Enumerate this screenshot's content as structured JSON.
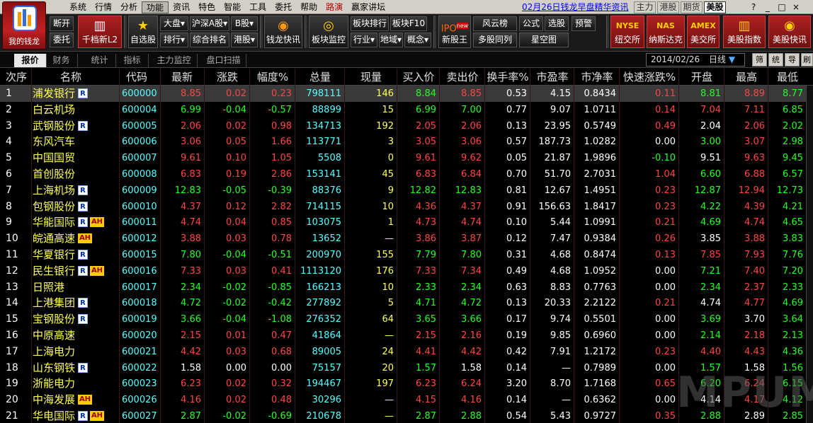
{
  "app": {
    "logo_label": "我的钱龙"
  },
  "menu": [
    "系统",
    "行情",
    "分析",
    "功能",
    "资讯",
    "特色",
    "智能",
    "工具",
    "委托",
    "帮助",
    "路演",
    "赢家讲坛"
  ],
  "menu_active_index": 3,
  "menu_red_index": 10,
  "news_link": "02月26日钱龙早盘精华资讯",
  "market_tabs": [
    "主力",
    "港股",
    "期货",
    "美股"
  ],
  "market_active": "美股",
  "window_controls": [
    "?",
    "_",
    "□",
    "×"
  ],
  "toolbar": {
    "disconnect": "断开",
    "entrust": "委托",
    "l2": "千档新L2",
    "mystock": "自选股",
    "dapan": "大盘",
    "rank": "排行",
    "hushen_a": "沪深A股",
    "composite_rank": "综合排名",
    "b_share": "B股",
    "hk": "港股",
    "qianlong_news": "钱龙快讯",
    "sector_monitor": "板块监控",
    "sector_rank": "板块排行",
    "sector_f10": "板块F10",
    "industry": "行业",
    "region": "地域",
    "concept": "概念",
    "new_stock": "新股王",
    "new_badge": "new",
    "fengyun": "风云榜",
    "multi_stock": "多股同列",
    "formula": "公式",
    "select_stock": "选股",
    "star_map": "星空图",
    "alert": "预警",
    "nyse_logo": "NYSE",
    "nyse": "纽交所",
    "nas_logo": "NAS",
    "nasdaq": "纳斯达克",
    "amex_logo": "AMEX",
    "amex": "美交所",
    "us_index": "美股指数",
    "us_news": "美股快讯"
  },
  "subtabs": [
    "报价",
    "财务",
    "统计",
    "指标",
    "主力监控",
    "盘口扫描"
  ],
  "subtab_active": "报价",
  "date": "2014/02/26",
  "period": "日线",
  "period_arrow": "▼",
  "right_buttons": [
    "筛",
    "统",
    "导",
    "刷"
  ],
  "columns": [
    "次序",
    "名称",
    "代码",
    "最新",
    "涨跌",
    "幅度%",
    "总量",
    "现量",
    "买入价",
    "卖出价",
    "换手率%",
    "市盈率",
    "市净率",
    "快速涨跌%",
    "开盘",
    "最高",
    "最低"
  ],
  "rows": [
    {
      "seq": "1",
      "name": "浦发银行",
      "r": true,
      "ah": false,
      "code": "600000",
      "last": "8.85",
      "chg": "0.02",
      "pct": "0.23",
      "vol": "798111",
      "cur": "146",
      "bid": "8.84",
      "ask": "8.85",
      "turn": "0.53",
      "pe": "4.15",
      "pb": "0.8434",
      "fast": "0.11",
      "open": "8.81",
      "high": "8.89",
      "low": "8.77",
      "dir": "up",
      "fastdir": "up",
      "opendir": "dn",
      "highdir": "up",
      "lowdir": "dn",
      "biddir": "dn",
      "askdir": "up"
    },
    {
      "seq": "2",
      "name": "白云机场",
      "r": false,
      "ah": false,
      "code": "600004",
      "last": "6.99",
      "chg": "-0.04",
      "pct": "-0.57",
      "vol": "88899",
      "cur": "15",
      "bid": "6.99",
      "ask": "7.00",
      "turn": "0.77",
      "pe": "9.07",
      "pb": "1.0711",
      "fast": "0.14",
      "open": "7.04",
      "high": "7.11",
      "low": "6.85",
      "dir": "dn",
      "fastdir": "up",
      "opendir": "up",
      "highdir": "up",
      "lowdir": "dn",
      "biddir": "dn",
      "askdir": "dn"
    },
    {
      "seq": "3",
      "name": "武钢股份",
      "r": true,
      "ah": false,
      "code": "600005",
      "last": "2.06",
      "chg": "0.02",
      "pct": "0.98",
      "vol": "134713",
      "cur": "192",
      "bid": "2.05",
      "ask": "2.06",
      "turn": "0.13",
      "pe": "23.95",
      "pb": "0.5749",
      "fast": "0.49",
      "open": "2.04",
      "high": "2.06",
      "low": "2.02",
      "dir": "up",
      "fastdir": "up",
      "opendir": "flat",
      "highdir": "up",
      "lowdir": "dn",
      "biddir": "up",
      "askdir": "up"
    },
    {
      "seq": "4",
      "name": "东风汽车",
      "r": false,
      "ah": false,
      "code": "600006",
      "last": "3.06",
      "chg": "0.05",
      "pct": "1.66",
      "vol": "113771",
      "cur": "3",
      "bid": "3.05",
      "ask": "3.06",
      "turn": "0.57",
      "pe": "187.73",
      "pb": "1.0282",
      "fast": "0.00",
      "open": "3.00",
      "high": "3.07",
      "low": "2.98",
      "dir": "up",
      "fastdir": "flat",
      "opendir": "dn",
      "highdir": "up",
      "lowdir": "dn",
      "biddir": "up",
      "askdir": "up"
    },
    {
      "seq": "5",
      "name": "中国国贸",
      "r": false,
      "ah": false,
      "code": "600007",
      "last": "9.61",
      "chg": "0.10",
      "pct": "1.05",
      "vol": "5508",
      "cur": "0",
      "bid": "9.61",
      "ask": "9.62",
      "turn": "0.05",
      "pe": "21.87",
      "pb": "1.9896",
      "fast": "-0.10",
      "open": "9.51",
      "high": "9.63",
      "low": "9.45",
      "dir": "up",
      "fastdir": "dn",
      "opendir": "flat",
      "highdir": "up",
      "lowdir": "dn",
      "biddir": "up",
      "askdir": "up"
    },
    {
      "seq": "6",
      "name": "首创股份",
      "r": false,
      "ah": false,
      "code": "600008",
      "last": "6.83",
      "chg": "0.19",
      "pct": "2.86",
      "vol": "153141",
      "cur": "45",
      "bid": "6.83",
      "ask": "6.84",
      "turn": "0.70",
      "pe": "51.70",
      "pb": "2.7031",
      "fast": "1.04",
      "open": "6.60",
      "high": "6.88",
      "low": "6.57",
      "dir": "up",
      "fastdir": "up",
      "opendir": "dn",
      "highdir": "up",
      "lowdir": "dn",
      "biddir": "up",
      "askdir": "up"
    },
    {
      "seq": "7",
      "name": "上海机场",
      "r": true,
      "ah": false,
      "code": "600009",
      "last": "12.83",
      "chg": "-0.05",
      "pct": "-0.39",
      "vol": "88376",
      "cur": "9",
      "bid": "12.82",
      "ask": "12.83",
      "turn": "0.81",
      "pe": "12.67",
      "pb": "1.4951",
      "fast": "0.23",
      "open": "12.87",
      "high": "12.94",
      "low": "12.73",
      "dir": "dn",
      "fastdir": "up",
      "opendir": "dn",
      "highdir": "up",
      "lowdir": "dn",
      "biddir": "dn",
      "askdir": "dn"
    },
    {
      "seq": "8",
      "name": "包钢股份",
      "r": true,
      "ah": false,
      "code": "600010",
      "last": "4.37",
      "chg": "0.12",
      "pct": "2.82",
      "vol": "714115",
      "cur": "10",
      "bid": "4.36",
      "ask": "4.37",
      "turn": "0.91",
      "pe": "156.63",
      "pb": "1.8417",
      "fast": "0.23",
      "open": "4.22",
      "high": "4.39",
      "low": "4.21",
      "dir": "up",
      "fastdir": "up",
      "opendir": "dn",
      "highdir": "up",
      "lowdir": "dn",
      "biddir": "up",
      "askdir": "up"
    },
    {
      "seq": "9",
      "name": "华能国际",
      "r": true,
      "ah": true,
      "code": "600011",
      "last": "4.74",
      "chg": "0.04",
      "pct": "0.85",
      "vol": "103075",
      "cur": "1",
      "bid": "4.73",
      "ask": "4.74",
      "turn": "0.10",
      "pe": "5.44",
      "pb": "1.0991",
      "fast": "0.21",
      "open": "4.69",
      "high": "4.74",
      "low": "4.65",
      "dir": "up",
      "fastdir": "up",
      "opendir": "dn",
      "highdir": "up",
      "lowdir": "dn",
      "biddir": "up",
      "askdir": "up"
    },
    {
      "seq": "10",
      "name": "皖通高速",
      "r": false,
      "ah": true,
      "code": "600012",
      "last": "3.88",
      "chg": "0.03",
      "pct": "0.78",
      "vol": "13652",
      "cur": "—",
      "bid": "3.86",
      "ask": "3.87",
      "turn": "0.12",
      "pe": "7.47",
      "pb": "0.9384",
      "fast": "0.26",
      "open": "3.85",
      "high": "3.88",
      "low": "3.83",
      "dir": "up",
      "fastdir": "up",
      "opendir": "flat",
      "highdir": "up",
      "lowdir": "dn",
      "biddir": "up",
      "askdir": "up"
    },
    {
      "seq": "11",
      "name": "华夏银行",
      "r": true,
      "ah": false,
      "code": "600015",
      "last": "7.80",
      "chg": "-0.04",
      "pct": "-0.51",
      "vol": "200970",
      "cur": "155",
      "bid": "7.79",
      "ask": "7.80",
      "turn": "0.31",
      "pe": "4.68",
      "pb": "0.8474",
      "fast": "0.13",
      "open": "7.85",
      "high": "7.93",
      "low": "7.76",
      "dir": "dn",
      "fastdir": "up",
      "opendir": "up",
      "highdir": "up",
      "lowdir": "dn",
      "biddir": "dn",
      "askdir": "dn"
    },
    {
      "seq": "12",
      "name": "民生银行",
      "r": true,
      "ah": true,
      "code": "600016",
      "last": "7.33",
      "chg": "0.03",
      "pct": "0.41",
      "vol": "1113120",
      "cur": "176",
      "bid": "7.33",
      "ask": "7.34",
      "turn": "0.49",
      "pe": "4.68",
      "pb": "1.0952",
      "fast": "0.00",
      "open": "7.21",
      "high": "7.40",
      "low": "7.20",
      "dir": "up",
      "fastdir": "flat",
      "opendir": "dn",
      "highdir": "up",
      "lowdir": "dn",
      "biddir": "up",
      "askdir": "up"
    },
    {
      "seq": "13",
      "name": "日照港",
      "r": false,
      "ah": false,
      "code": "600017",
      "last": "2.34",
      "chg": "-0.02",
      "pct": "-0.85",
      "vol": "166213",
      "cur": "10",
      "bid": "2.33",
      "ask": "2.34",
      "turn": "0.63",
      "pe": "8.83",
      "pb": "0.7763",
      "fast": "0.00",
      "open": "2.34",
      "high": "2.37",
      "low": "2.33",
      "dir": "dn",
      "fastdir": "flat",
      "opendir": "dn",
      "highdir": "up",
      "lowdir": "dn",
      "biddir": "dn",
      "askdir": "dn"
    },
    {
      "seq": "14",
      "name": "上港集团",
      "r": true,
      "ah": false,
      "code": "600018",
      "last": "4.72",
      "chg": "-0.02",
      "pct": "-0.42",
      "vol": "277892",
      "cur": "5",
      "bid": "4.71",
      "ask": "4.72",
      "turn": "0.13",
      "pe": "20.33",
      "pb": "2.2122",
      "fast": "0.21",
      "open": "4.74",
      "high": "4.77",
      "low": "4.69",
      "dir": "dn",
      "fastdir": "up",
      "opendir": "flat",
      "highdir": "up",
      "lowdir": "dn",
      "biddir": "dn",
      "askdir": "dn"
    },
    {
      "seq": "15",
      "name": "宝钢股份",
      "r": true,
      "ah": false,
      "code": "600019",
      "last": "3.66",
      "chg": "-0.04",
      "pct": "-1.08",
      "vol": "276352",
      "cur": "64",
      "bid": "3.65",
      "ask": "3.66",
      "turn": "0.17",
      "pe": "9.74",
      "pb": "0.5501",
      "fast": "0.00",
      "open": "3.69",
      "high": "3.70",
      "low": "3.64",
      "dir": "dn",
      "fastdir": "flat",
      "opendir": "dn",
      "highdir": "flat",
      "lowdir": "dn",
      "biddir": "dn",
      "askdir": "dn"
    },
    {
      "seq": "16",
      "name": "中原高速",
      "r": false,
      "ah": false,
      "code": "600020",
      "last": "2.15",
      "chg": "0.01",
      "pct": "0.47",
      "vol": "41864",
      "cur": "—",
      "bid": "2.15",
      "ask": "2.16",
      "turn": "0.19",
      "pe": "9.85",
      "pb": "0.6960",
      "fast": "0.00",
      "open": "2.14",
      "high": "2.18",
      "low": "2.13",
      "dir": "up",
      "fastdir": "flat",
      "opendir": "dn",
      "highdir": "up",
      "lowdir": "dn",
      "biddir": "up",
      "askdir": "up"
    },
    {
      "seq": "17",
      "name": "上海电力",
      "r": false,
      "ah": false,
      "code": "600021",
      "last": "4.42",
      "chg": "0.03",
      "pct": "0.68",
      "vol": "89005",
      "cur": "24",
      "bid": "4.41",
      "ask": "4.42",
      "turn": "0.42",
      "pe": "7.91",
      "pb": "1.2172",
      "fast": "0.23",
      "open": "4.40",
      "high": "4.43",
      "low": "4.36",
      "dir": "up",
      "fastdir": "up",
      "opendir": "up",
      "highdir": "up",
      "lowdir": "dn",
      "biddir": "up",
      "askdir": "up"
    },
    {
      "seq": "18",
      "name": "山东钢铁",
      "r": true,
      "ah": false,
      "code": "600022",
      "last": "1.58",
      "chg": "0.00",
      "pct": "0.00",
      "vol": "75157",
      "cur": "20",
      "bid": "1.57",
      "ask": "1.58",
      "turn": "0.14",
      "pe": "—",
      "pb": "0.7989",
      "fast": "0.00",
      "open": "1.57",
      "high": "1.58",
      "low": "1.56",
      "dir": "flat",
      "fastdir": "flat",
      "opendir": "dn",
      "highdir": "flat",
      "lowdir": "dn",
      "biddir": "dn",
      "askdir": "flat"
    },
    {
      "seq": "19",
      "name": "浙能电力",
      "r": false,
      "ah": false,
      "code": "600023",
      "last": "6.23",
      "chg": "0.02",
      "pct": "0.32",
      "vol": "194467",
      "cur": "197",
      "bid": "6.23",
      "ask": "6.24",
      "turn": "3.20",
      "pe": "8.70",
      "pb": "1.7168",
      "fast": "0.65",
      "open": "6.20",
      "high": "6.24",
      "low": "6.15",
      "dir": "up",
      "fastdir": "up",
      "opendir": "dn",
      "highdir": "up",
      "lowdir": "dn",
      "biddir": "up",
      "askdir": "up"
    },
    {
      "seq": "20",
      "name": "中海发展",
      "r": false,
      "ah": true,
      "code": "600026",
      "last": "4.16",
      "chg": "0.02",
      "pct": "0.48",
      "vol": "30296",
      "cur": "—",
      "bid": "4.15",
      "ask": "4.16",
      "turn": "0.14",
      "pe": "—",
      "pb": "0.6362",
      "fast": "0.00",
      "open": "4.14",
      "high": "4.17",
      "low": "4.12",
      "dir": "up",
      "fastdir": "flat",
      "opendir": "flat",
      "highdir": "up",
      "lowdir": "dn",
      "biddir": "up",
      "askdir": "up"
    },
    {
      "seq": "21",
      "name": "华电国际",
      "r": true,
      "ah": true,
      "code": "600027",
      "last": "2.87",
      "chg": "-0.02",
      "pct": "-0.69",
      "vol": "210678",
      "cur": "—",
      "bid": "2.87",
      "ask": "2.88",
      "turn": "0.54",
      "pe": "5.43",
      "pb": "0.9727",
      "fast": "0.35",
      "open": "2.88",
      "high": "2.89",
      "low": "2.85",
      "dir": "dn",
      "fastdir": "up",
      "opendir": "dn",
      "highdir": "flat",
      "lowdir": "dn",
      "biddir": "dn",
      "askdir": "dn"
    }
  ],
  "watermark": "MPUM",
  "colors": {
    "up": "#ff4444",
    "down": "#22ff22",
    "flat": "#ffffff",
    "name": "#ffff55",
    "code": "#55ffff"
  }
}
